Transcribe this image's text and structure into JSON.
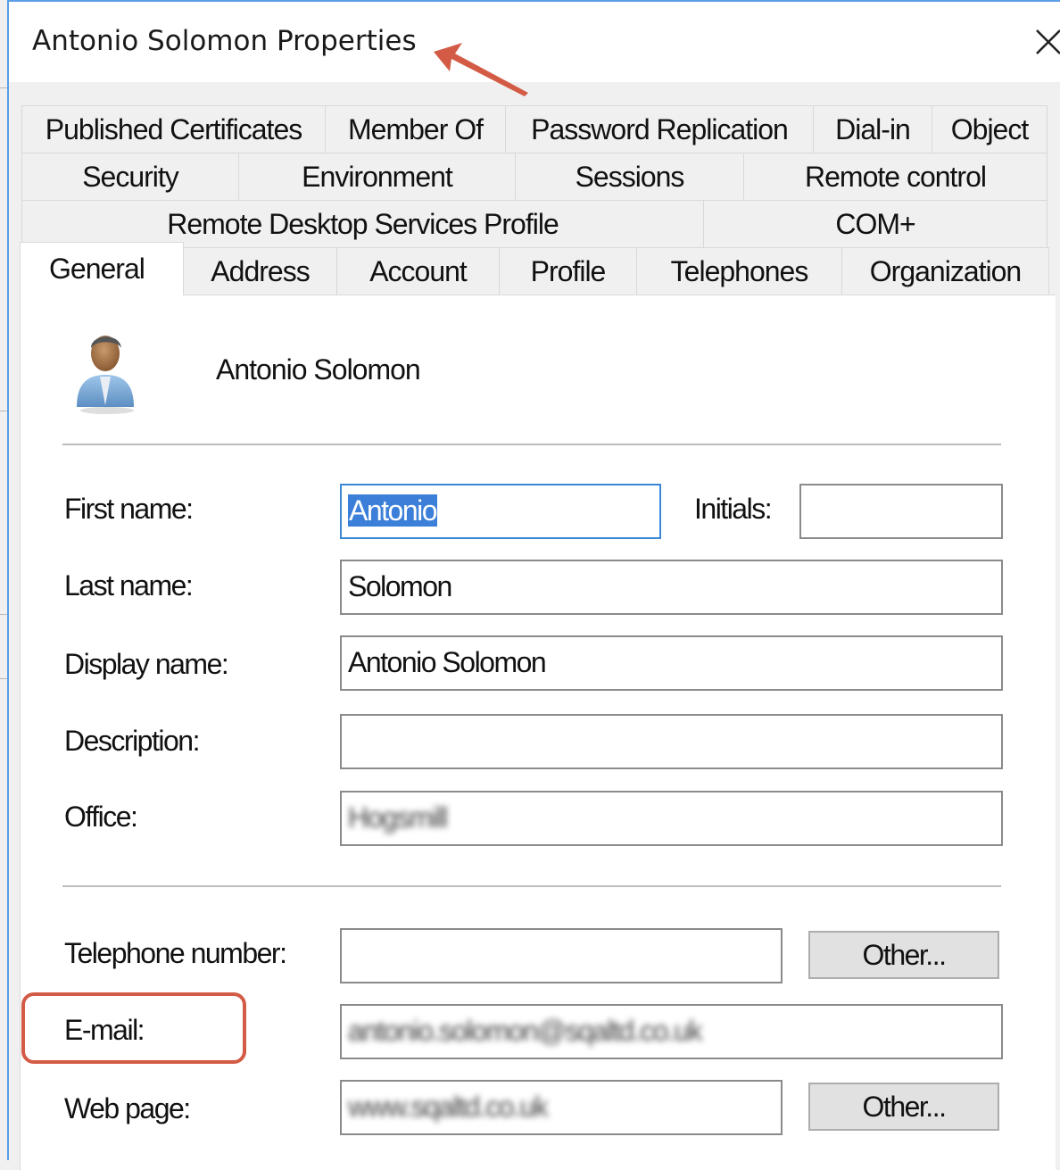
{
  "window": {
    "title": "Antonio Solomon Properties",
    "close_icon": "close-icon"
  },
  "tabs": {
    "row1": [
      "Published Certificates",
      "Member Of",
      "Password Replication",
      "Dial-in",
      "Object"
    ],
    "row2": [
      "Security",
      "Environment",
      "Sessions",
      "Remote control"
    ],
    "row3": [
      "Remote Desktop Services Profile",
      "COM+"
    ],
    "row4": [
      "General",
      "Address",
      "Account",
      "Profile",
      "Telephones",
      "Organization"
    ],
    "active": "General"
  },
  "general": {
    "user_icon": "user-avatar-icon",
    "header_name": "Antonio Solomon",
    "fields": {
      "first_name": {
        "label": "First name:",
        "value": "Antonio",
        "selected": true
      },
      "initials": {
        "label": "Initials:",
        "value": ""
      },
      "last_name": {
        "label": "Last name:",
        "value": "Solomon"
      },
      "display_name": {
        "label": "Display name:",
        "value": "Antonio Solomon"
      },
      "description": {
        "label": "Description:",
        "value": ""
      },
      "office": {
        "label": "Office:",
        "value": "Hogsmill",
        "redacted": true
      },
      "telephone": {
        "label": "Telephone number:",
        "value": ""
      },
      "email": {
        "label": "E-mail:",
        "value": "antonio.solomon@sqaltd.co.uk",
        "redacted": true
      },
      "web_page": {
        "label": "Web page:",
        "value": "www.sqaltd.co.uk",
        "redacted": true
      }
    },
    "buttons": {
      "telephone_other": "Other...",
      "web_page_other": "Other..."
    }
  },
  "annotations": {
    "color": "#d35b45",
    "highlight_target": "E-mail:",
    "arrow_target": "window title"
  }
}
